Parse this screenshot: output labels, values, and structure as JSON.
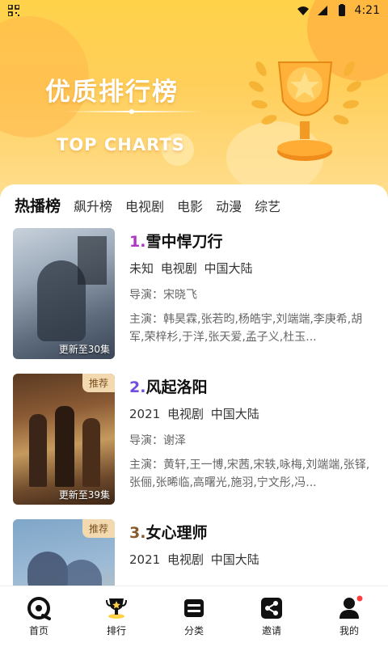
{
  "status": {
    "time": "4:21"
  },
  "hero": {
    "title": "优质排行榜",
    "subtitle": "TOP CHARTS"
  },
  "tabs": [
    {
      "label": "热播榜",
      "active": true
    },
    {
      "label": "飙升榜",
      "active": false
    },
    {
      "label": "电视剧",
      "active": false
    },
    {
      "label": "电影",
      "active": false
    },
    {
      "label": "动漫",
      "active": false
    },
    {
      "label": "综艺",
      "active": false
    }
  ],
  "items": [
    {
      "rank": "1.",
      "rank_color": "#b036c8",
      "title": "雪中悍刀行",
      "meta": "未知 电视剧 中国大陆",
      "director": "导演：宋晓飞",
      "cast": "主演：韩昊霖,张若昀,杨皓宇,刘端端,李庚希,胡军,荣梓杉,于洋,张天爱,孟子义,杜玉...",
      "badge": "",
      "update": "更新至30集"
    },
    {
      "rank": "2.",
      "rank_color": "#6f4ee0",
      "title": "风起洛阳",
      "meta": "2021 电视剧 中国大陆",
      "director": "导演：谢泽",
      "cast": "主演：黄轩,王一博,宋茜,宋轶,咏梅,刘端端,张铎,张俪,张晞临,高曙光,施羽,宁文彤,冯...",
      "badge": "推荐",
      "update": "更新至39集"
    },
    {
      "rank": "3.",
      "rank_color": "#8a5a2c",
      "title": "女心理师",
      "meta": "2021 电视剧 中国大陆",
      "director": "",
      "cast": "",
      "badge": "推荐",
      "update": ""
    }
  ],
  "nav": [
    {
      "label": "首页",
      "icon": "home-icon"
    },
    {
      "label": "排行",
      "icon": "trophy-icon"
    },
    {
      "label": "分类",
      "icon": "category-icon"
    },
    {
      "label": "邀请",
      "icon": "share-icon"
    },
    {
      "label": "我的",
      "icon": "profile-icon"
    }
  ],
  "colors": {
    "accent": "#ffd24a",
    "badge": "#f3d9b0",
    "dot": "#ff4040"
  }
}
